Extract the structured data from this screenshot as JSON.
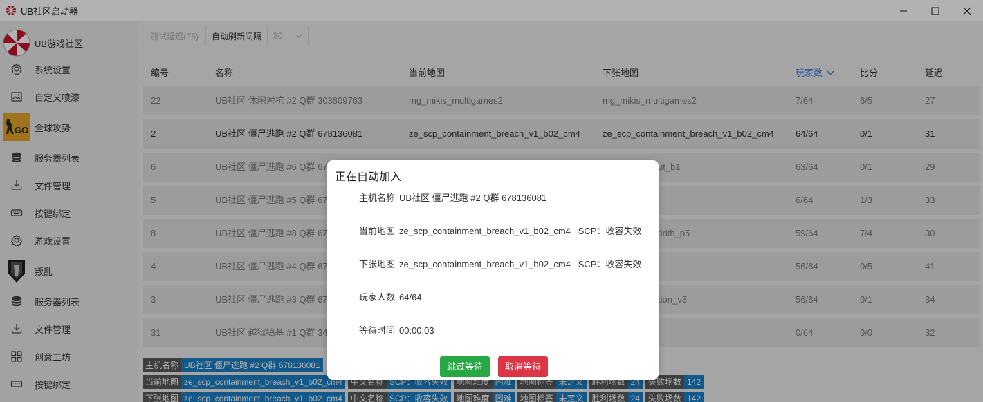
{
  "window": {
    "title": "UB社区启动器"
  },
  "sidebar": {
    "community_label": "UB游戏社区",
    "items": [
      {
        "label": "系统设置"
      },
      {
        "label": "自定义喷漆"
      },
      {
        "label": "全球攻势"
      },
      {
        "label": "服务器列表"
      },
      {
        "label": "文件管理"
      },
      {
        "label": "按键绑定"
      },
      {
        "label": "游戏设置"
      },
      {
        "label": "叛乱"
      },
      {
        "label": "服务器列表"
      },
      {
        "label": "文件管理"
      },
      {
        "label": "创意工坊"
      },
      {
        "label": "按键绑定"
      }
    ]
  },
  "toolbar": {
    "ping_test_label": "测试延迟(F5)",
    "auto_refresh_label": "自动刷新间隔",
    "auto_refresh_value": "30"
  },
  "table": {
    "headers": {
      "id": "编号",
      "name": "名称",
      "map": "当前地图",
      "next_map": "下张地图",
      "players": "玩家数",
      "score": "比分",
      "ping": "延迟"
    },
    "rows": [
      {
        "id": "22",
        "name": "UB社区 休闲对抗 #2 Q群 303809763",
        "map": "mg_mikis_multigames2",
        "next_map": "mg_mikis_multigames2",
        "players": "7/64",
        "score": "6/5",
        "ping": "27"
      },
      {
        "id": "2",
        "name": "UB社区 僵尸逃跑 #2 Q群 678136081",
        "map": "ze_scp_containment_breach_v1_b02_cm4",
        "next_map": "ze_scp_containment_breach_v1_b02_cm4",
        "players": "64/64",
        "score": "0/1",
        "ping": "31"
      },
      {
        "id": "6",
        "name": "UB社区 僵尸逃跑 #6 Q群 678",
        "map": "",
        "next_map": "ut_b1",
        "players": "63/64",
        "score": "0/1",
        "ping": "29"
      },
      {
        "id": "5",
        "name": "UB社区 僵尸逃跑 #5 Q群 678",
        "map": "",
        "next_map": "",
        "players": "6/64",
        "score": "1/3",
        "ping": "33"
      },
      {
        "id": "8",
        "name": "UB社区 僵尸逃跑 #8 Q群 678",
        "map": "",
        "next_map": "tirith_p5",
        "players": "59/64",
        "score": "7/4",
        "ping": "30"
      },
      {
        "id": "4",
        "name": "UB社区 僵尸逃跑 #4 Q群 678",
        "map": "",
        "next_map": "",
        "players": "56/64",
        "score": "0/5",
        "ping": "41"
      },
      {
        "id": "3",
        "name": "UB社区 僵尸逃跑 #3 Q群 678",
        "map": "",
        "next_map": "tion_v3",
        "players": "56/64",
        "score": "0/1",
        "ping": "34"
      },
      {
        "id": "31",
        "name": "UB社区 越狱搞基 #1 Q群 346",
        "map": "",
        "next_map": "",
        "players": "0/64",
        "score": "0/0",
        "ping": "32"
      }
    ]
  },
  "infobar": {
    "host": {
      "k": "主机名称",
      "v": "UB社区 僵尸逃跑 #2 Q群 678136081"
    },
    "current": [
      {
        "k": "当前地图",
        "v": "ze_scp_containment_breach_v1_b02_cm4"
      },
      {
        "k": "中文名称",
        "v": "SCP：收容失效"
      },
      {
        "k": "地图难度",
        "v": "困难"
      },
      {
        "k": "地图标签",
        "v": "未定义"
      },
      {
        "k": "胜利场数",
        "v": "24"
      },
      {
        "k": "失败场数",
        "v": "142"
      }
    ],
    "next": [
      {
        "k": "下张地图",
        "v": "ze_scp_containment_breach_v1_b02_cm4"
      },
      {
        "k": "中文名称",
        "v": "SCP：收容失效"
      },
      {
        "k": "地图难度",
        "v": "困难"
      },
      {
        "k": "地图标签",
        "v": "未定义"
      },
      {
        "k": "胜利场数",
        "v": "24"
      },
      {
        "k": "失败场数",
        "v": "142"
      }
    ]
  },
  "dialog": {
    "title": "正在自动加入",
    "host_label": "主机名称",
    "host_value": "UB社区 僵尸逃跑 #2 Q群 678136081",
    "map_label": "当前地图",
    "map_value": "ze_scp_containment_breach_v1_b02_cm4   SCP：收容失效",
    "next_label": "下张地图",
    "next_value": "ze_scp_containment_breach_v1_b02_cm4   SCP：收容失效",
    "players_label": "玩家人数",
    "players_value": "64/64",
    "wait_label": "等待时间",
    "wait_value": "00:00:03",
    "skip_label": "跳过等待",
    "cancel_label": "取消等待"
  },
  "colors": {
    "accent": "#3b7ddd",
    "tag_value": "#1a7fc4",
    "skip": "#28a745",
    "cancel": "#dc3545"
  }
}
